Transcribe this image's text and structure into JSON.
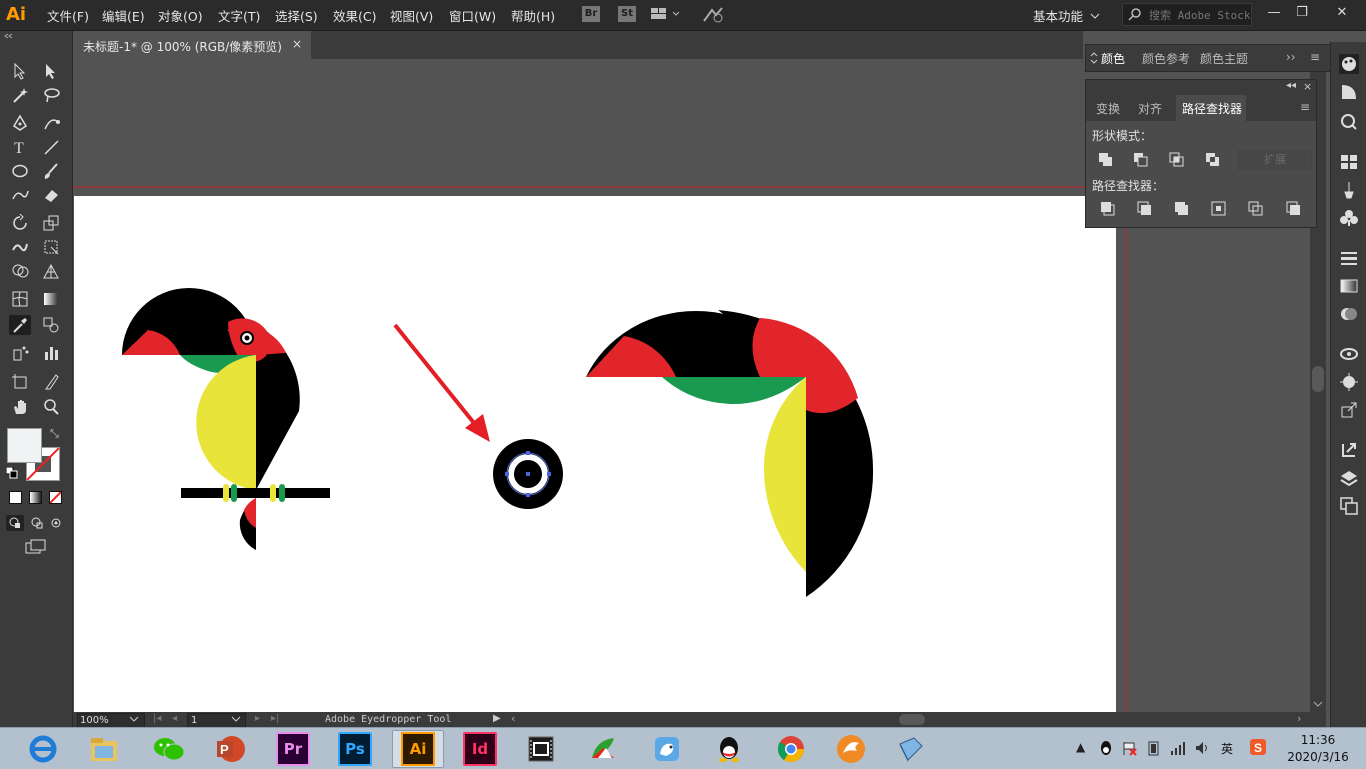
{
  "app": {
    "logo": "Ai",
    "menu": [
      "文件(F)",
      "编辑(E)",
      "对象(O)",
      "文字(T)",
      "选择(S)",
      "效果(C)",
      "视图(V)",
      "窗口(W)",
      "帮助(H)"
    ],
    "bridge_badge": "Br",
    "stock_badge": "St",
    "workspace": "基本功能",
    "search_placeholder": "搜索 Adobe Stock"
  },
  "document": {
    "tab_title": "未标题-1* @ 100% (RGB/像素预览)",
    "close_glyph": "×"
  },
  "panels": {
    "color_tabs": [
      "颜色",
      "颜色参考",
      "颜色主题"
    ],
    "transform_tabs": [
      "变换",
      "对齐",
      "路径查找器"
    ],
    "shape_modes_label": "形状模式：",
    "pathfinders_label": "路径查找器：",
    "expand_button": "扩展"
  },
  "status": {
    "zoom": "100%",
    "page": "1",
    "tool_name": "Adobe Eyedropper Tool"
  },
  "taskbar": {
    "apps": [
      "ie-icon",
      "explorer-icon",
      "wechat-icon",
      "powerpoint-icon",
      "premiere-icon",
      "photoshop-icon",
      "illustrator-icon",
      "indesign-icon",
      "video-icon",
      "browser-icon",
      "bird-icon",
      "qq-icon",
      "chrome-icon",
      "thunder-icon",
      "disk-icon"
    ],
    "pr_label": "Pr",
    "ps_label": "Ps",
    "ai_label": "Ai",
    "id_label": "Id",
    "p_label": "P",
    "ime_label": "英",
    "time": "11:36",
    "date": "2020/3/16"
  },
  "colors": {
    "toucan_black": "#000000",
    "toucan_red": "#e2252b",
    "toucan_green": "#1a9a50",
    "toucan_yellow": "#e8e43a",
    "arrow_red": "#e31e24",
    "guide_red": "#c72128"
  }
}
